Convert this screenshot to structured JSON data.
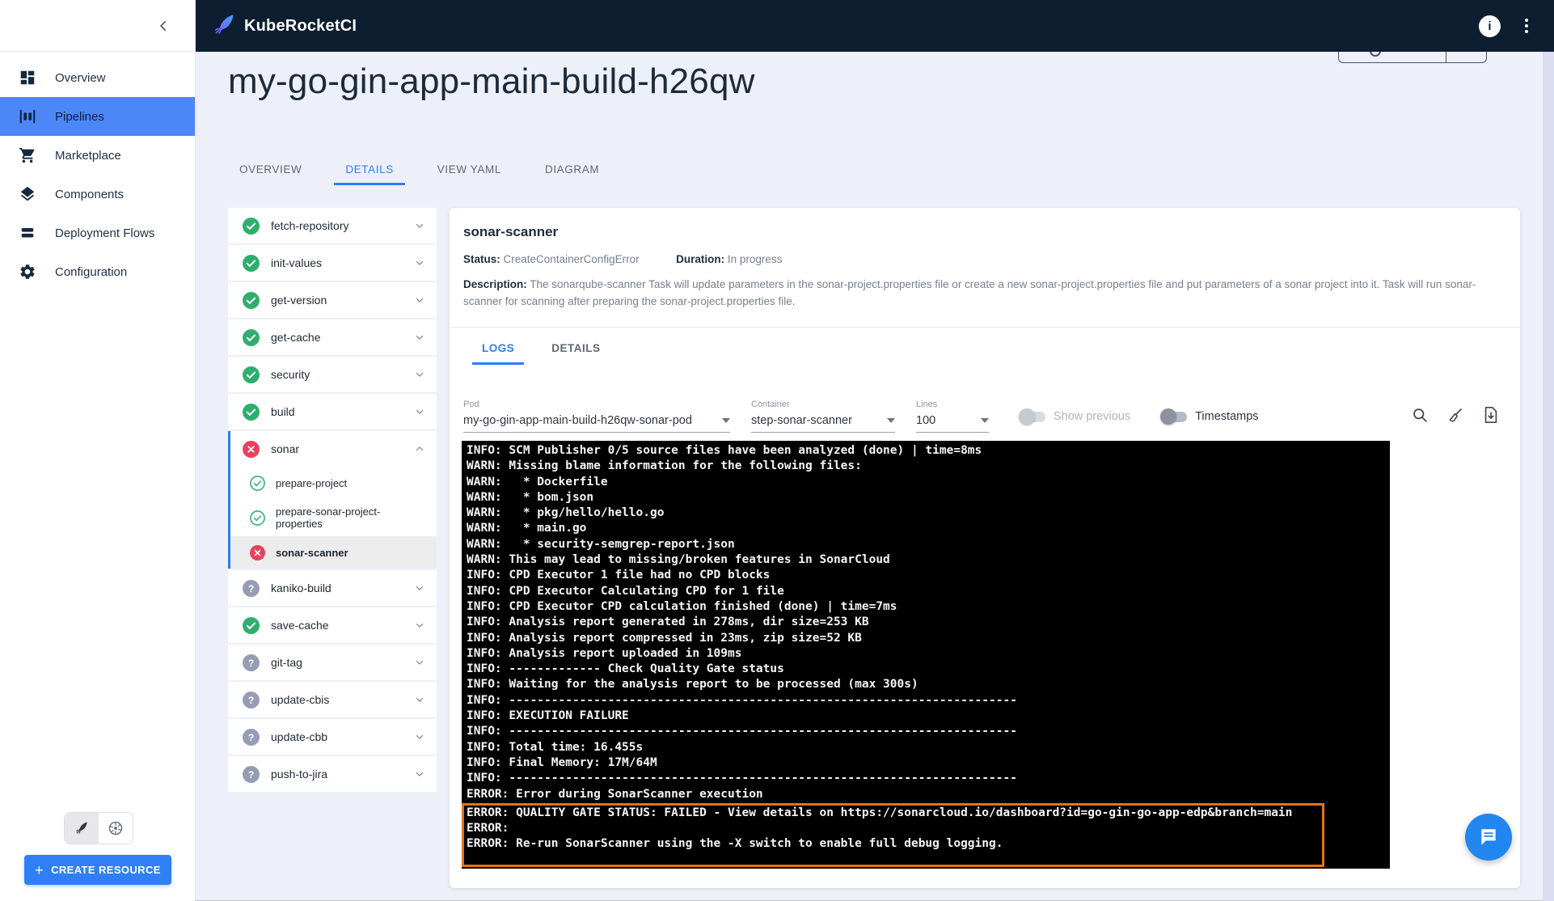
{
  "colors": {
    "accent": "#2f7cf6",
    "header_bg": "#0d1e30",
    "sidebar_active": "#4c87f7",
    "success": "#2fae6d",
    "error": "#e8415f",
    "pending": "#959db4",
    "log_highlight_border": "#e87210",
    "create_button_bg": "#2f80f7"
  },
  "header": {
    "brand": "KubeRocketCI"
  },
  "sidebar": {
    "items": [
      {
        "label": "Overview",
        "icon": "dashboard-icon",
        "active": false
      },
      {
        "label": "Pipelines",
        "icon": "pipelines-icon",
        "active": true
      },
      {
        "label": "Marketplace",
        "icon": "cart-icon",
        "active": false
      },
      {
        "label": "Components",
        "icon": "layers-icon",
        "active": false
      },
      {
        "label": "Deployment Flows",
        "icon": "stack-icon",
        "active": false
      },
      {
        "label": "Configuration",
        "icon": "gear-icon",
        "active": false
      }
    ],
    "create_button": "CREATE RESOURCE"
  },
  "page": {
    "title": "my-go-gin-app-main-build-h26qw",
    "tabs": [
      "OVERVIEW",
      "DETAILS",
      "VIEW YAML",
      "DIAGRAM"
    ],
    "active_tab": "DETAILS"
  },
  "tasks": [
    {
      "label": "fetch-repository",
      "status": "success"
    },
    {
      "label": "init-values",
      "status": "success"
    },
    {
      "label": "get-version",
      "status": "success"
    },
    {
      "label": "get-cache",
      "status": "success"
    },
    {
      "label": "security",
      "status": "success"
    },
    {
      "label": "build",
      "status": "success"
    },
    {
      "label": "sonar",
      "status": "error",
      "expanded": true,
      "children": [
        {
          "label": "prepare-project",
          "status": "success-outline"
        },
        {
          "label": "prepare-sonar-project-properties",
          "status": "success-outline"
        },
        {
          "label": "sonar-scanner",
          "status": "error",
          "selected": true
        }
      ]
    },
    {
      "label": "kaniko-build",
      "status": "pending"
    },
    {
      "label": "save-cache",
      "status": "success"
    },
    {
      "label": "git-tag",
      "status": "pending"
    },
    {
      "label": "update-cbis",
      "status": "pending"
    },
    {
      "label": "update-cbb",
      "status": "pending"
    },
    {
      "label": "push-to-jira",
      "status": "pending"
    }
  ],
  "panel": {
    "title": "sonar-scanner",
    "status_label": "Status:",
    "status_value": "CreateContainerConfigError",
    "duration_label": "Duration:",
    "duration_value": "In progress",
    "description_label": "Description:",
    "description": "The sonarqube-scanner Task will update parameters in the sonar-project.properties file or create a new sonar-project.properties file and put parameters of a sonar project into it. Task will run sonar-scanner for scanning after preparing the sonar-project.properties file.",
    "tabs": [
      "LOGS",
      "DETAILS"
    ],
    "active_tab": "LOGS",
    "pod": {
      "label": "Pod",
      "value": "my-go-gin-app-main-build-h26qw-sonar-pod"
    },
    "container": {
      "label": "Container",
      "value": "step-sonar-scanner"
    },
    "lines": {
      "label": "Lines",
      "value": "100"
    },
    "toggles": [
      {
        "label": "Show previous",
        "on": false,
        "disabled": true
      },
      {
        "label": "Timestamps",
        "on": false,
        "disabled": false
      }
    ],
    "log": {
      "highlight_start_index": 23,
      "lines": [
        "INFO: SCM Publisher 0/5 source files have been analyzed (done) | time=8ms",
        "WARN: Missing blame information for the following files:",
        "WARN:   * Dockerfile",
        "WARN:   * bom.json",
        "WARN:   * pkg/hello/hello.go",
        "WARN:   * main.go",
        "WARN:   * security-semgrep-report.json",
        "WARN: This may lead to missing/broken features in SonarCloud",
        "INFO: CPD Executor 1 file had no CPD blocks",
        "INFO: CPD Executor Calculating CPD for 1 file",
        "INFO: CPD Executor CPD calculation finished (done) | time=7ms",
        "INFO: Analysis report generated in 278ms, dir size=253 KB",
        "INFO: Analysis report compressed in 23ms, zip size=52 KB",
        "INFO: Analysis report uploaded in 109ms",
        "INFO: ------------- Check Quality Gate status",
        "INFO: Waiting for the analysis report to be processed (max 300s)",
        "INFO: ------------------------------------------------------------------------",
        "INFO: EXECUTION FAILURE",
        "INFO: ------------------------------------------------------------------------",
        "INFO: Total time: 16.455s",
        "INFO: Final Memory: 17M/64M",
        "INFO: ------------------------------------------------------------------------",
        "ERROR: Error during SonarScanner execution",
        "ERROR: QUALITY GATE STATUS: FAILED - View details on https://sonarcloud.io/dashboard?id=go-gin-go-app-edp&branch=main",
        "ERROR:",
        "ERROR: Re-run SonarScanner using the -X switch to enable full debug logging."
      ]
    }
  }
}
